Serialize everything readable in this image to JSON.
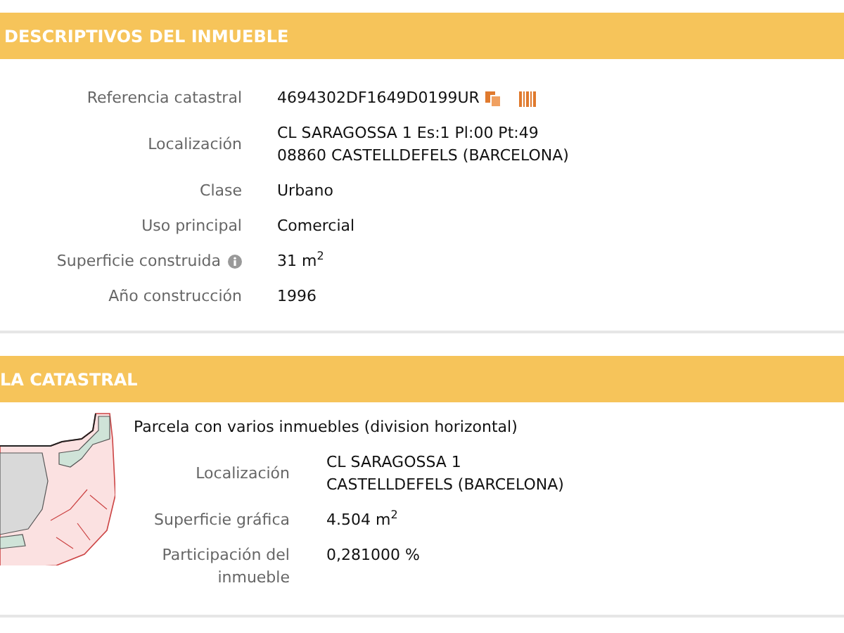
{
  "sections": [
    {
      "title": "DESCRIPTIVOS DEL INMUEBLE",
      "rows": [
        {
          "kind": "reference",
          "label": "Referencia catastral",
          "lines": [
            "4694302DF1649D0199UR"
          ]
        },
        {
          "kind": "plain",
          "label": "Localización",
          "lines": [
            "CL SARAGOSSA 1 Es:1 Pl:00 Pt:49",
            "08860 CASTELLDEFELS (BARCELONA)"
          ]
        },
        {
          "kind": "plain",
          "label": "Clase",
          "lines": [
            "Urbano"
          ]
        },
        {
          "kind": "plain",
          "label": "Uso principal",
          "lines": [
            "Comercial"
          ]
        },
        {
          "kind": "info",
          "label": "Superficie construida",
          "lines": [
            "31 m$^{2}$"
          ]
        },
        {
          "kind": "plain",
          "label": "Año construcción",
          "lines": [
            "1996"
          ]
        }
      ]
    },
    {
      "title": "LA CATASTRAL",
      "kind": "parcel",
      "note": "Parcela con varios inmuebles (division horizontal)",
      "rows": [
        {
          "kind": "plain",
          "label": "Localización",
          "lines": [
            "CL SARAGOSSA 1",
            "CASTELLDEFELS (BARCELONA)"
          ]
        },
        {
          "kind": "plain",
          "label": "Superficie gráfica",
          "lines": [
            "4.504 m$^{2}$"
          ]
        },
        {
          "kind": "plain",
          "label": "Participación del inmueble",
          "lines": [
            "0,281000 %"
          ]
        }
      ]
    }
  ]
}
